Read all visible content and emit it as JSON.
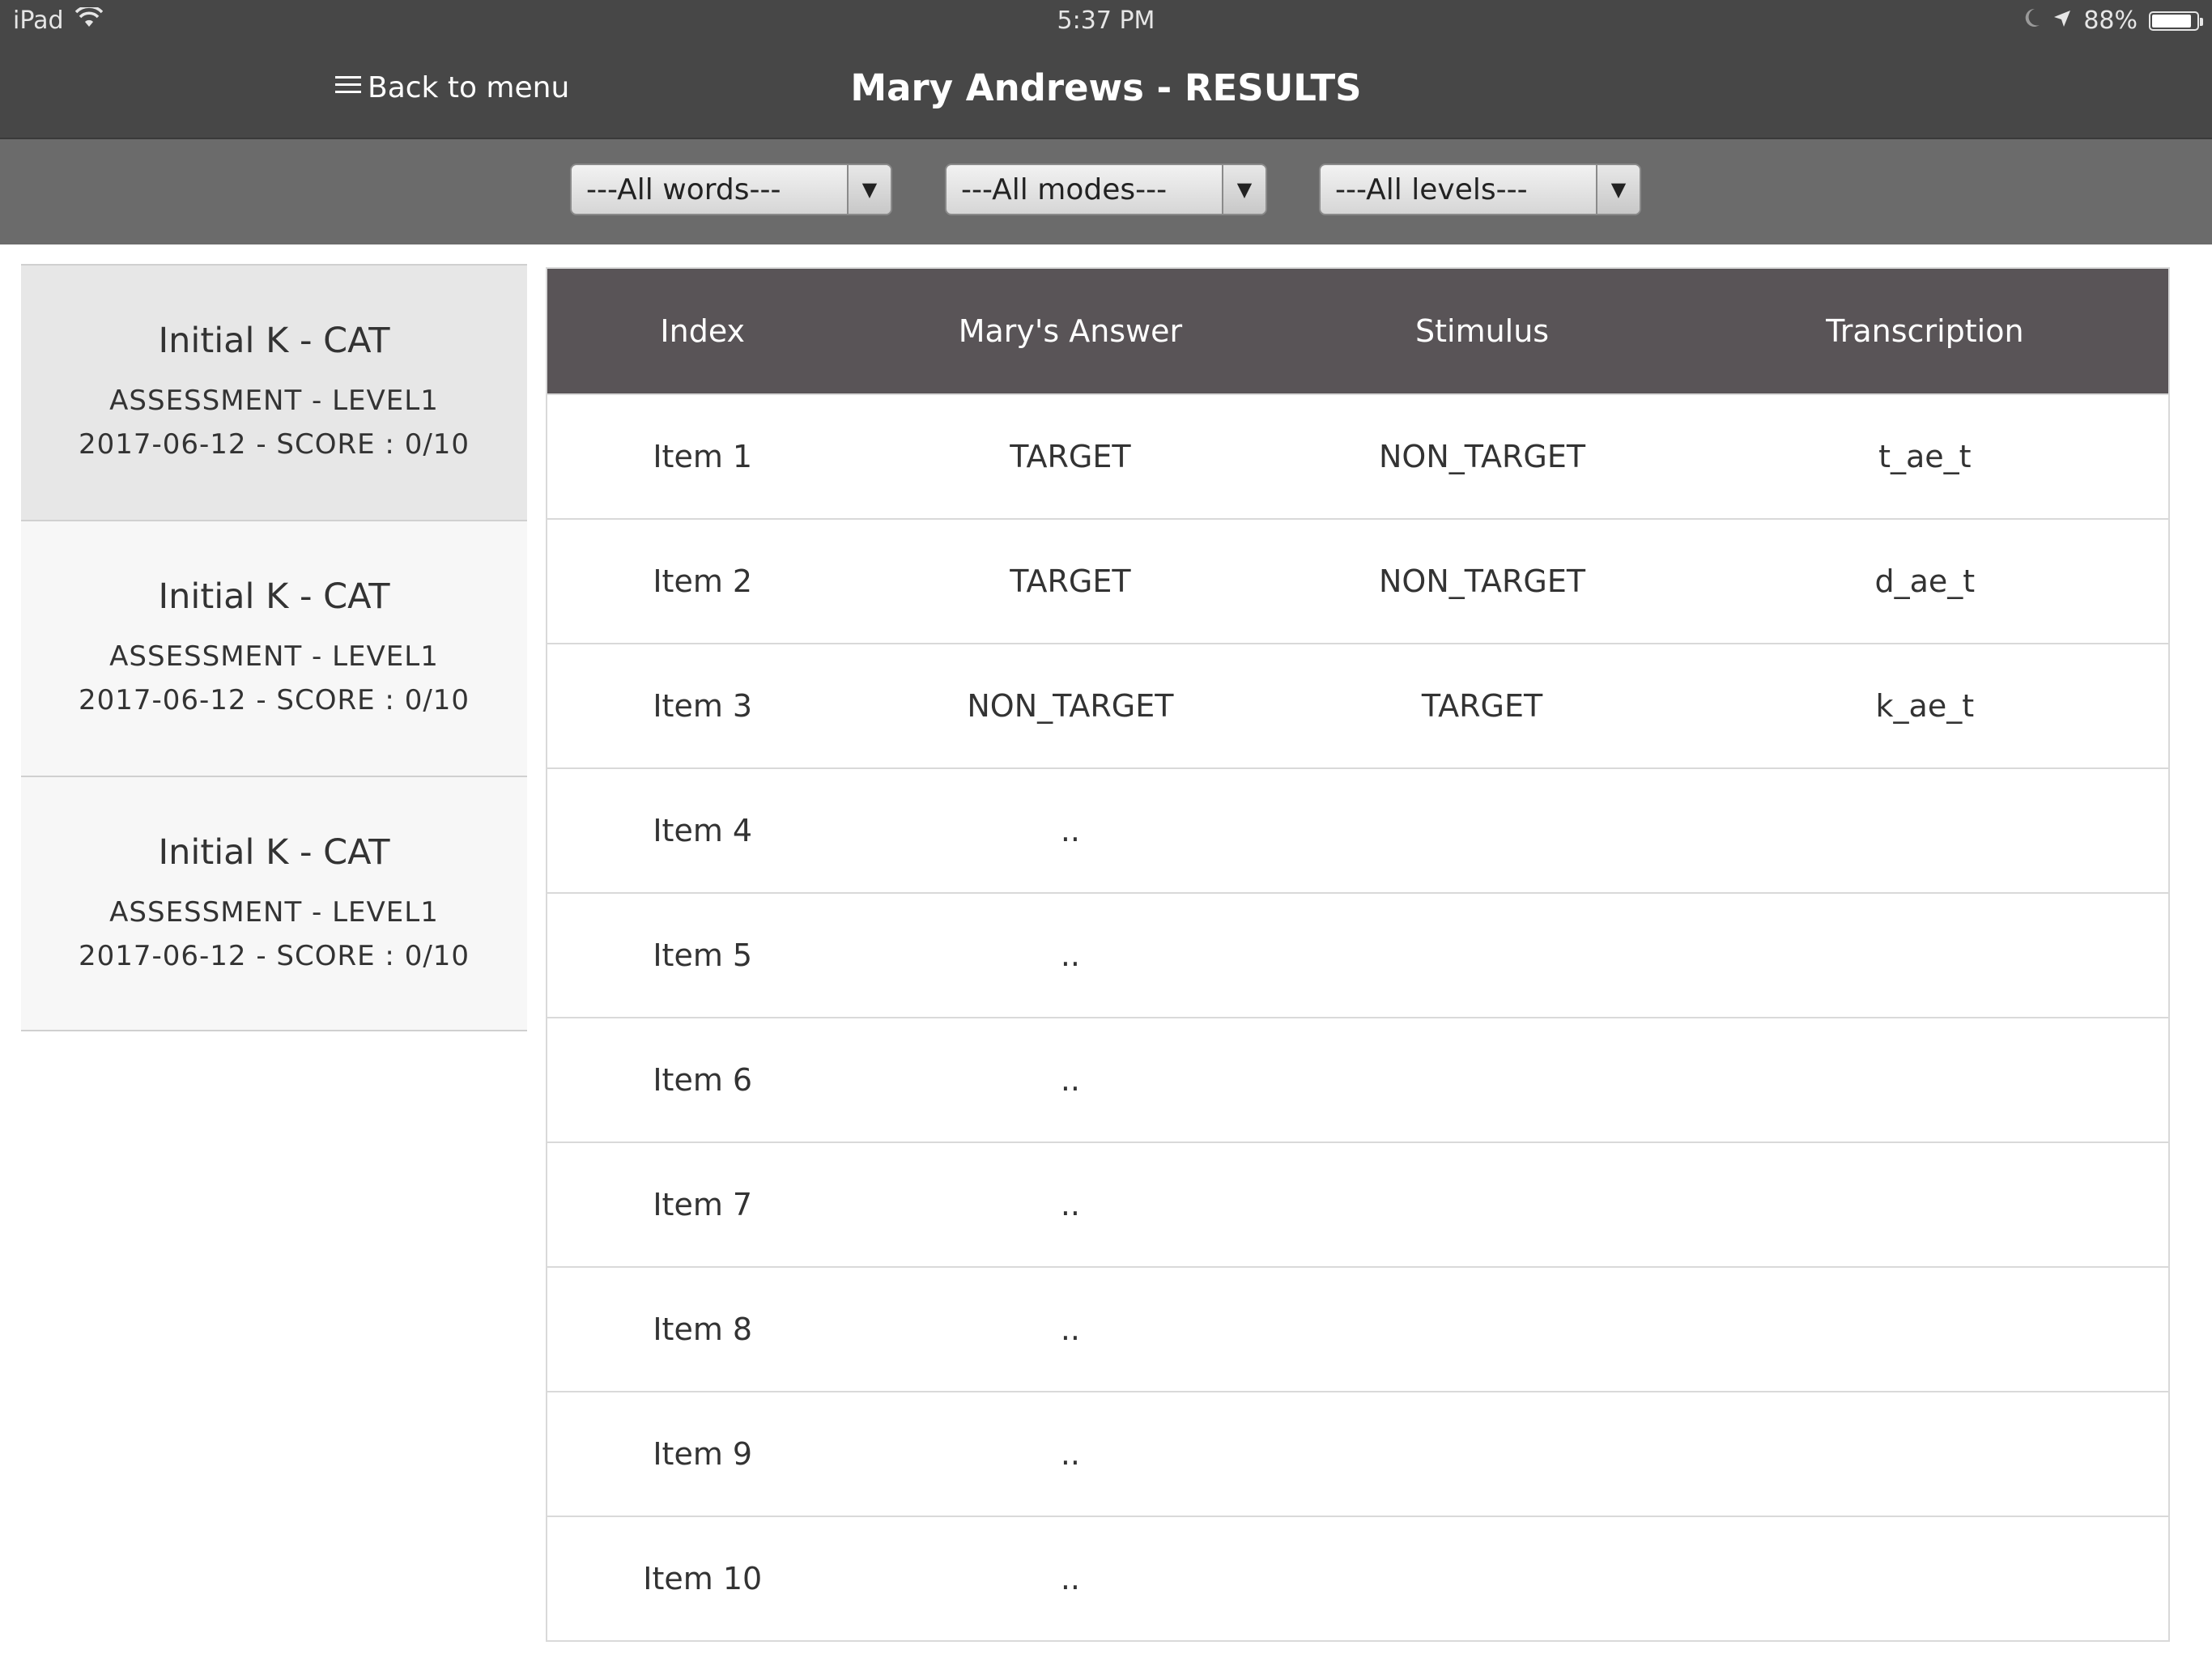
{
  "status_bar": {
    "device": "iPad",
    "time": "5:37 PM",
    "battery": "88%",
    "battery_level": 0.88
  },
  "header": {
    "back_label": "Back to menu",
    "title": "Mary Andrews - RESULTS"
  },
  "filters": [
    {
      "label": "---All words---"
    },
    {
      "label": "---All modes---"
    },
    {
      "label": "---All levels---"
    }
  ],
  "sessions": [
    {
      "title": "Initial K - CAT",
      "type": "ASSESSMENT - LEVEL1",
      "date_score": "2017-06-12 - SCORE : 0/10",
      "selected": true
    },
    {
      "title": "Initial K - CAT",
      "type": "ASSESSMENT - LEVEL1",
      "date_score": "2017-06-12 - SCORE : 0/10",
      "selected": false
    },
    {
      "title": "Initial K - CAT",
      "type": "ASSESSMENT - LEVEL1",
      "date_score": "2017-06-12 - SCORE : 0/10",
      "selected": false
    }
  ],
  "table": {
    "headers": [
      "Index",
      "Mary's Answer",
      "Stimulus",
      "Transcription"
    ],
    "rows": [
      [
        "Item 1",
        "TARGET",
        "NON_TARGET",
        "t_ae_t"
      ],
      [
        "Item 2",
        "TARGET",
        "NON_TARGET",
        "d_ae_t"
      ],
      [
        "Item 3",
        "NON_TARGET",
        "TARGET",
        "k_ae_t"
      ],
      [
        "Item 4",
        "..",
        "",
        ""
      ],
      [
        "Item 5",
        "..",
        "",
        ""
      ],
      [
        "Item 6",
        "..",
        "",
        ""
      ],
      [
        "Item 7",
        "..",
        "",
        ""
      ],
      [
        "Item 8",
        "..",
        "",
        ""
      ],
      [
        "Item 9",
        "..",
        "",
        ""
      ],
      [
        "Item 10",
        "..",
        "",
        ""
      ]
    ]
  }
}
